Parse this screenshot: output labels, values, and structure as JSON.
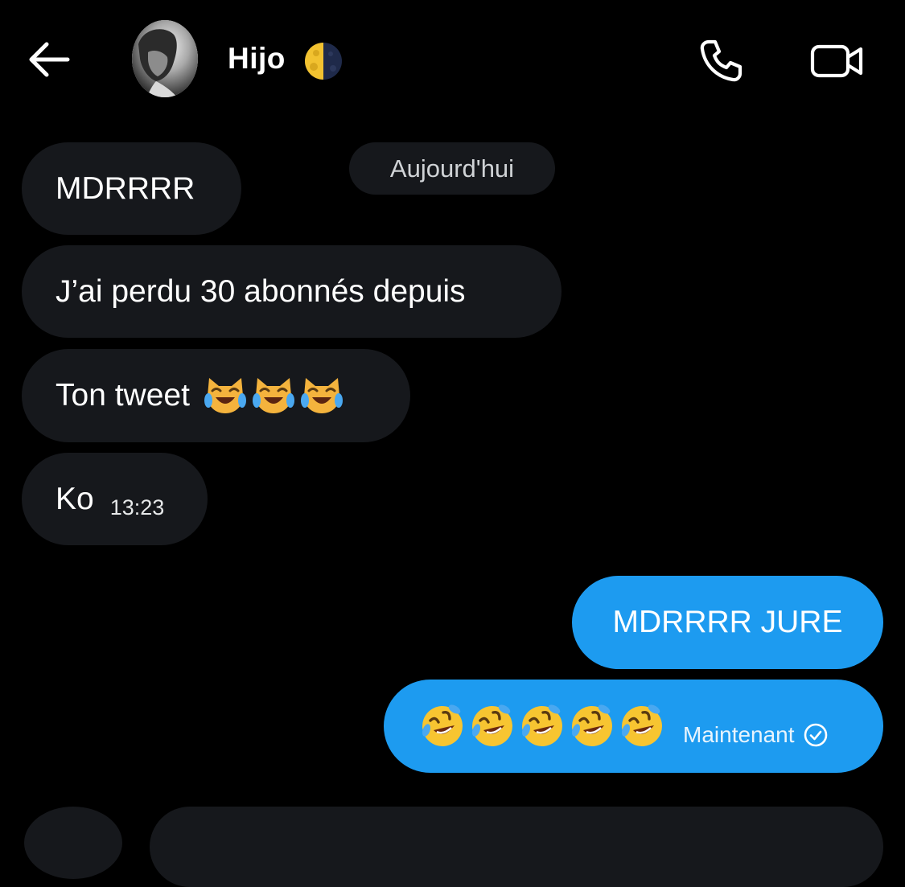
{
  "header": {
    "contact_name": "Hijo",
    "name_emoji": "moon-icon",
    "back_icon": "arrow-left-icon",
    "call_icon": "phone-icon",
    "video_icon": "video-camera-icon"
  },
  "date_separator": "Aujourd'hui",
  "messages": [
    {
      "direction": "received",
      "text": "MDRRRR"
    },
    {
      "direction": "received",
      "text": "J’ai perdu 30 abonnés depuis"
    },
    {
      "direction": "received",
      "text": "Ton tweet",
      "emojis": [
        "cat-tears-of-joy-icon",
        "cat-tears-of-joy-icon",
        "cat-tears-of-joy-icon"
      ]
    },
    {
      "direction": "received",
      "text": "Ko",
      "time": "13:23"
    },
    {
      "direction": "sent",
      "text": "MDRRRR JURE"
    },
    {
      "direction": "sent",
      "emojis": [
        "rolling-laughing-icon",
        "rolling-laughing-icon",
        "rolling-laughing-icon",
        "rolling-laughing-icon",
        "rolling-laughing-icon"
      ],
      "status": "Maintenant",
      "status_icon": "check-circle-icon"
    }
  ],
  "colors": {
    "background": "#000000",
    "received_bubble": "#16181c",
    "sent_bubble": "#1d9bf0",
    "text": "#ffffff"
  }
}
